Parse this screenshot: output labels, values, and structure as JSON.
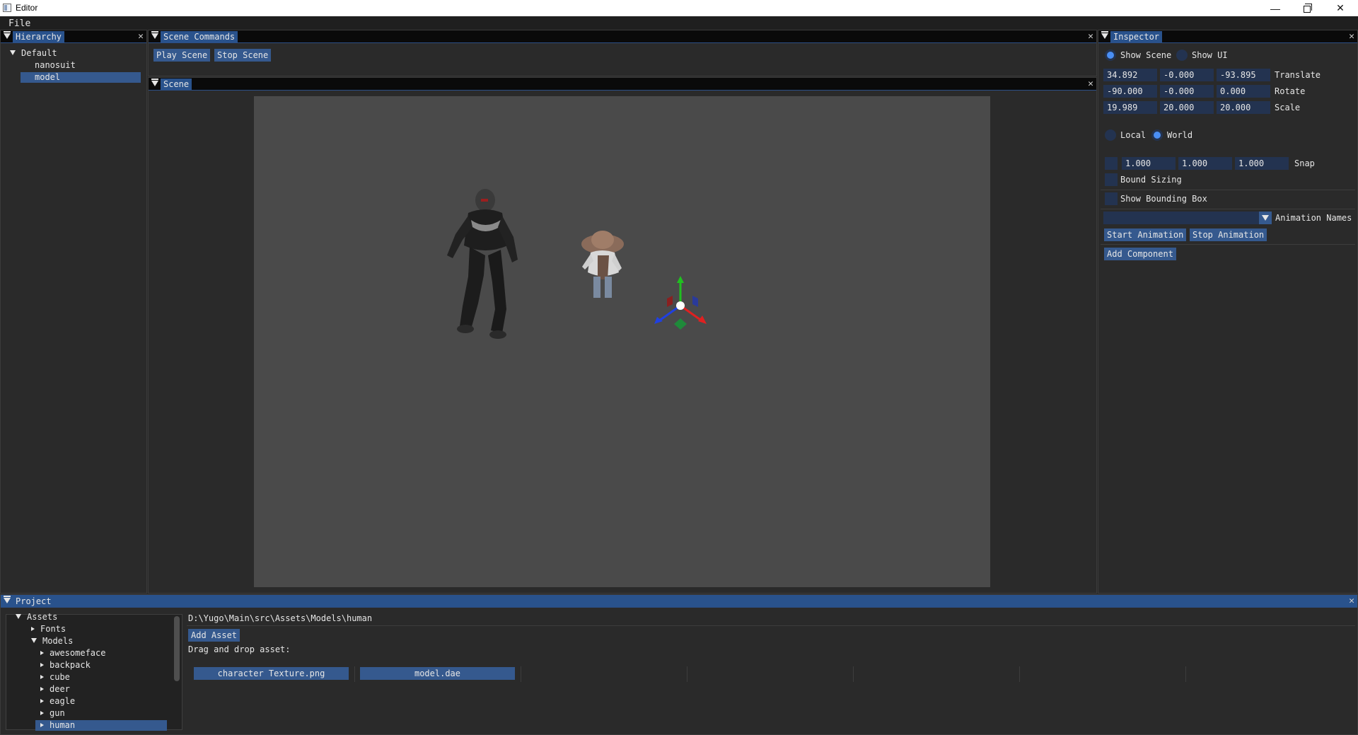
{
  "window": {
    "title": "Editor",
    "controls": [
      "—",
      "❐",
      "✕"
    ]
  },
  "menu": {
    "items": [
      "File"
    ]
  },
  "hierarchy": {
    "title": "Hierarchy",
    "root": "Default",
    "items": [
      "nanosuit",
      "model"
    ],
    "selected": "model"
  },
  "scene_commands": {
    "title": "Scene Commands",
    "play_label": "Play Scene",
    "stop_label": "Stop Scene"
  },
  "scene": {
    "title": "Scene",
    "background_color": "#4a4a4a"
  },
  "inspector": {
    "title": "Inspector",
    "show_scene_label": "Show Scene",
    "show_ui_label": "Show UI",
    "show_scene_selected": true,
    "show_ui_selected": false,
    "transform": {
      "translate": {
        "label": "Translate",
        "values": [
          "34.892",
          "-0.000",
          "-93.895"
        ]
      },
      "rotate": {
        "label": "Rotate",
        "values": [
          "-90.000",
          "-0.000",
          "0.000"
        ]
      },
      "scale": {
        "label": "Scale",
        "values": [
          "19.989",
          "20.000",
          "20.000"
        ]
      }
    },
    "space": {
      "local_label": "Local",
      "world_label": "World",
      "selected": "World"
    },
    "snap": {
      "label": "Snap",
      "values": [
        "1.000",
        "1.000",
        "1.000"
      ],
      "checked": false
    },
    "bound_sizing": {
      "label": "Bound Sizing",
      "checked": false
    },
    "show_bounding_box": {
      "label": "Show Bounding Box",
      "checked": false
    },
    "animation": {
      "names_label": "Animation Names",
      "selected_value": "",
      "start_label": "Start Animation",
      "stop_label": "Stop Animation"
    },
    "add_component_label": "Add Component"
  },
  "project": {
    "title": "Project",
    "tree": {
      "root": "Assets",
      "fonts": "Fonts",
      "models": "Models",
      "model_items": [
        "awesomeface",
        "backpack",
        "cube",
        "deer",
        "eagle",
        "gun",
        "human"
      ],
      "selected": "human"
    },
    "path": "D:\\Yugo\\Main\\src\\Assets\\Models\\human",
    "add_asset_label": "Add Asset",
    "drag_drop_label": "Drag and drop asset:",
    "assets": [
      "character Texture.png",
      "model.dae"
    ]
  },
  "colors": {
    "accent": "#35598e",
    "header_active": "#29528c",
    "field_bg": "#233350",
    "radio_on": "#4a8ff5",
    "gizmo_x": "#e02020",
    "gizmo_y": "#20c020",
    "gizmo_z": "#2040e0"
  },
  "icons": [
    "collapse-triangle-icon",
    "close-icon",
    "tree-arrow-icon",
    "combo-arrow-icon",
    "transform-gizmo-icon"
  ]
}
